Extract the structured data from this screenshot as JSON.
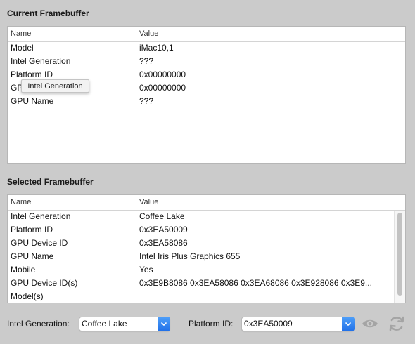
{
  "current": {
    "title": "Current Framebuffer",
    "headers": {
      "name": "Name",
      "value": "Value"
    },
    "rows": [
      {
        "name": "Model",
        "value": "iMac10,1"
      },
      {
        "name": "Intel Generation",
        "value": "???"
      },
      {
        "name": "Platform ID",
        "value": "0x00000000"
      },
      {
        "name": "GPU Device ID",
        "value": "0x00000000"
      },
      {
        "name": "GPU Name",
        "value": "???"
      }
    ],
    "tooltip": "Intel Generation"
  },
  "selected": {
    "title": "Selected Framebuffer",
    "headers": {
      "name": "Name",
      "value": "Value"
    },
    "rows": [
      {
        "name": "Intel Generation",
        "value": "Coffee Lake"
      },
      {
        "name": "Platform ID",
        "value": "0x3EA50009"
      },
      {
        "name": "GPU Device ID",
        "value": "0x3EA58086"
      },
      {
        "name": "GPU Name",
        "value": "Intel Iris Plus Graphics 655"
      },
      {
        "name": "Mobile",
        "value": "Yes"
      },
      {
        "name": "GPU Device ID(s)",
        "value": "0x3E9B8086 0x3EA58086 0x3EA68086 0x3E928086 0x3E9..."
      },
      {
        "name": "Model(s)",
        "value": ""
      }
    ]
  },
  "controls": {
    "intel_generation_label": "Intel Generation:",
    "intel_generation_value": "Coffee Lake",
    "platform_id_label": "Platform ID:",
    "platform_id_value": "0x3EA50009",
    "icons": [
      "eye-icon",
      "refresh-icon"
    ],
    "accent": "#1f6fe8"
  }
}
